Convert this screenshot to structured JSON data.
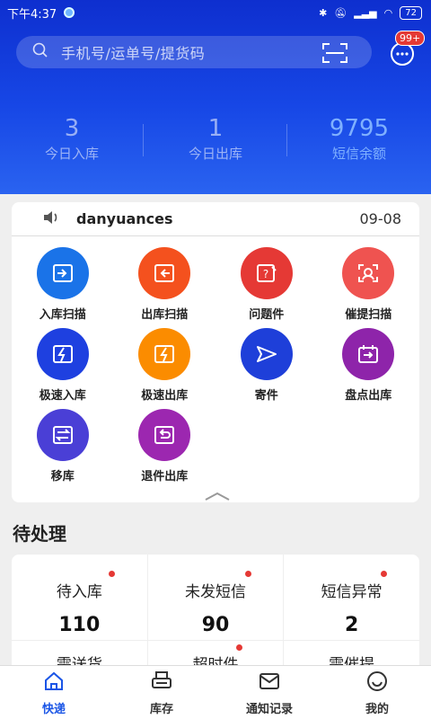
{
  "status_bar": {
    "time": "下午4:37",
    "battery": "72"
  },
  "search": {
    "placeholder": "手机号/运单号/提货码",
    "icons": [
      "search-icon",
      "scan-icon"
    ]
  },
  "messages": {
    "badge": "99+",
    "icon": "chat-icon"
  },
  "stats": [
    {
      "value": "3",
      "label": "今日入库"
    },
    {
      "value": "1",
      "label": "今日出库"
    },
    {
      "value": "9795",
      "label": "短信余额"
    }
  ],
  "notice": {
    "name": "danyuances",
    "date": "09-08"
  },
  "actions": [
    {
      "label": "入库扫描",
      "icon": "inbound-scan-icon",
      "color": "#1a73e8"
    },
    {
      "label": "出库扫描",
      "icon": "outbound-scan-icon",
      "color": "#f4511e"
    },
    {
      "label": "问题件",
      "icon": "problem-item-icon",
      "color": "#e53935"
    },
    {
      "label": "催提扫描",
      "icon": "urge-pickup-icon",
      "color": "#ef5350"
    },
    {
      "label": "极速入库",
      "icon": "fast-inbound-icon",
      "color": "#1e40e0"
    },
    {
      "label": "极速出库",
      "icon": "fast-outbound-icon",
      "color": "#fb8c00"
    },
    {
      "label": "寄件",
      "icon": "send-icon",
      "color": "#1e3fd9"
    },
    {
      "label": "盘点出库",
      "icon": "inventory-out-icon",
      "color": "#8e24aa"
    },
    {
      "label": "移库",
      "icon": "transfer-icon",
      "color": "#4a3fd6"
    },
    {
      "label": "退件出库",
      "icon": "return-icon",
      "color": "#9c27b0"
    }
  ],
  "section_title": "待处理",
  "pending": [
    {
      "label": "待入库",
      "value": "110",
      "dot": true
    },
    {
      "label": "未发短信",
      "value": "90",
      "dot": true
    },
    {
      "label": "短信异常",
      "value": "2",
      "dot": true
    }
  ],
  "pending_row2": [
    {
      "label": "需送货",
      "dot": false
    },
    {
      "label": "超时件",
      "dot": true
    },
    {
      "label": "需催提",
      "dot": false
    }
  ],
  "tabs": [
    {
      "label": "快递",
      "icon": "home-icon",
      "active": true
    },
    {
      "label": "库存",
      "icon": "printer-icon",
      "active": false
    },
    {
      "label": "通知记录",
      "icon": "mail-icon",
      "active": false
    },
    {
      "label": "我的",
      "icon": "smile-icon",
      "active": false
    }
  ],
  "colors": {
    "header_top": "#0e2fcf",
    "header_bottom": "#2a63f0",
    "accent": "#1a55e6",
    "badge": "#e53935"
  }
}
